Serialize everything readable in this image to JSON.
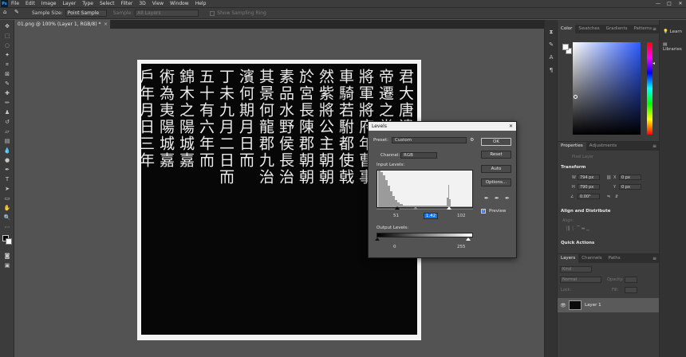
{
  "menubar": {
    "app_icon": "Ps",
    "items": [
      "File",
      "Edit",
      "Image",
      "Layer",
      "Type",
      "Select",
      "Filter",
      "3D",
      "View",
      "Window",
      "Help"
    ],
    "controls": [
      "—",
      "□",
      "✕"
    ]
  },
  "options": {
    "tool_icon": "eyedropper-icon",
    "sample_size_label": "Sample Size:",
    "sample_size_value": "Point Sample",
    "sample_label": "Sample:",
    "sample_value": "All Layers",
    "show_ring_label": "Show Sampling Ring"
  },
  "document": {
    "tab_title": "01.png @ 100% (Layer 1, RGB/8) *",
    "close": "×"
  },
  "calligraphy_columns": [
    "君大唐遺竟曹事",
    "帝遷之嘗猶之嘗",
    "將軍將府年曹事",
    "車騎若駙都使戟",
    "然紫將公主朝朝",
    "於宮長陳郡朝朝",
    "素品水野侯長治",
    "其景何龍郡九治",
    "濱何期月日而",
    "丁未九月二日而",
    "五十有六年而",
    "錦木之陽城嘉",
    "術為夷陽城嘉",
    "戶年月日三年"
  ],
  "dialog": {
    "title": "Levels",
    "close": "✕",
    "preset_label": "Preset:",
    "preset_value": "Custom",
    "channel_label": "Channel:",
    "channel_value": "RGB",
    "input_levels_label": "Input Levels:",
    "input_black": "51",
    "input_gamma": "1.42",
    "input_white": "102",
    "output_levels_label": "Output Levels:",
    "output_black": "0",
    "output_white": "255",
    "buttons": [
      "OK",
      "Reset",
      "Auto",
      "Options..."
    ],
    "preview_label": "Preview",
    "preview_checked": true
  },
  "color_panel": {
    "tabs": [
      "Color",
      "Swatches",
      "Gradients",
      "Patterns"
    ]
  },
  "properties_panel": {
    "tabs": [
      "Properties",
      "Adjustments"
    ],
    "kind": "Pixel Layer",
    "transform_label": "Transform",
    "w_label": "W",
    "w_value": "794 px",
    "h_label": "H",
    "h_value": "790 px",
    "x_label": "X",
    "x_value": "0 px",
    "y_label": "Y",
    "y_value": "0 px",
    "angle_value": "0.00°",
    "align_label": "Align and Distribute",
    "align_sub": "Align:",
    "quick_actions": "Quick Actions"
  },
  "layers_panel": {
    "tabs": [
      "Layers",
      "Channels",
      "Paths"
    ],
    "kind_value": "Kind",
    "blend_mode": "Normal",
    "opacity_label": "Opacity:",
    "lock_label": "Lock:",
    "fill_label": "Fill:",
    "layer_name": "Layer 1"
  },
  "right_strip": {
    "learn_label": "Learn",
    "libraries_label": "Libraries"
  },
  "colors": {
    "ui_dark": "#3c3c3c",
    "canvas_bg": "#535353",
    "highlight": "#1a73e8"
  }
}
